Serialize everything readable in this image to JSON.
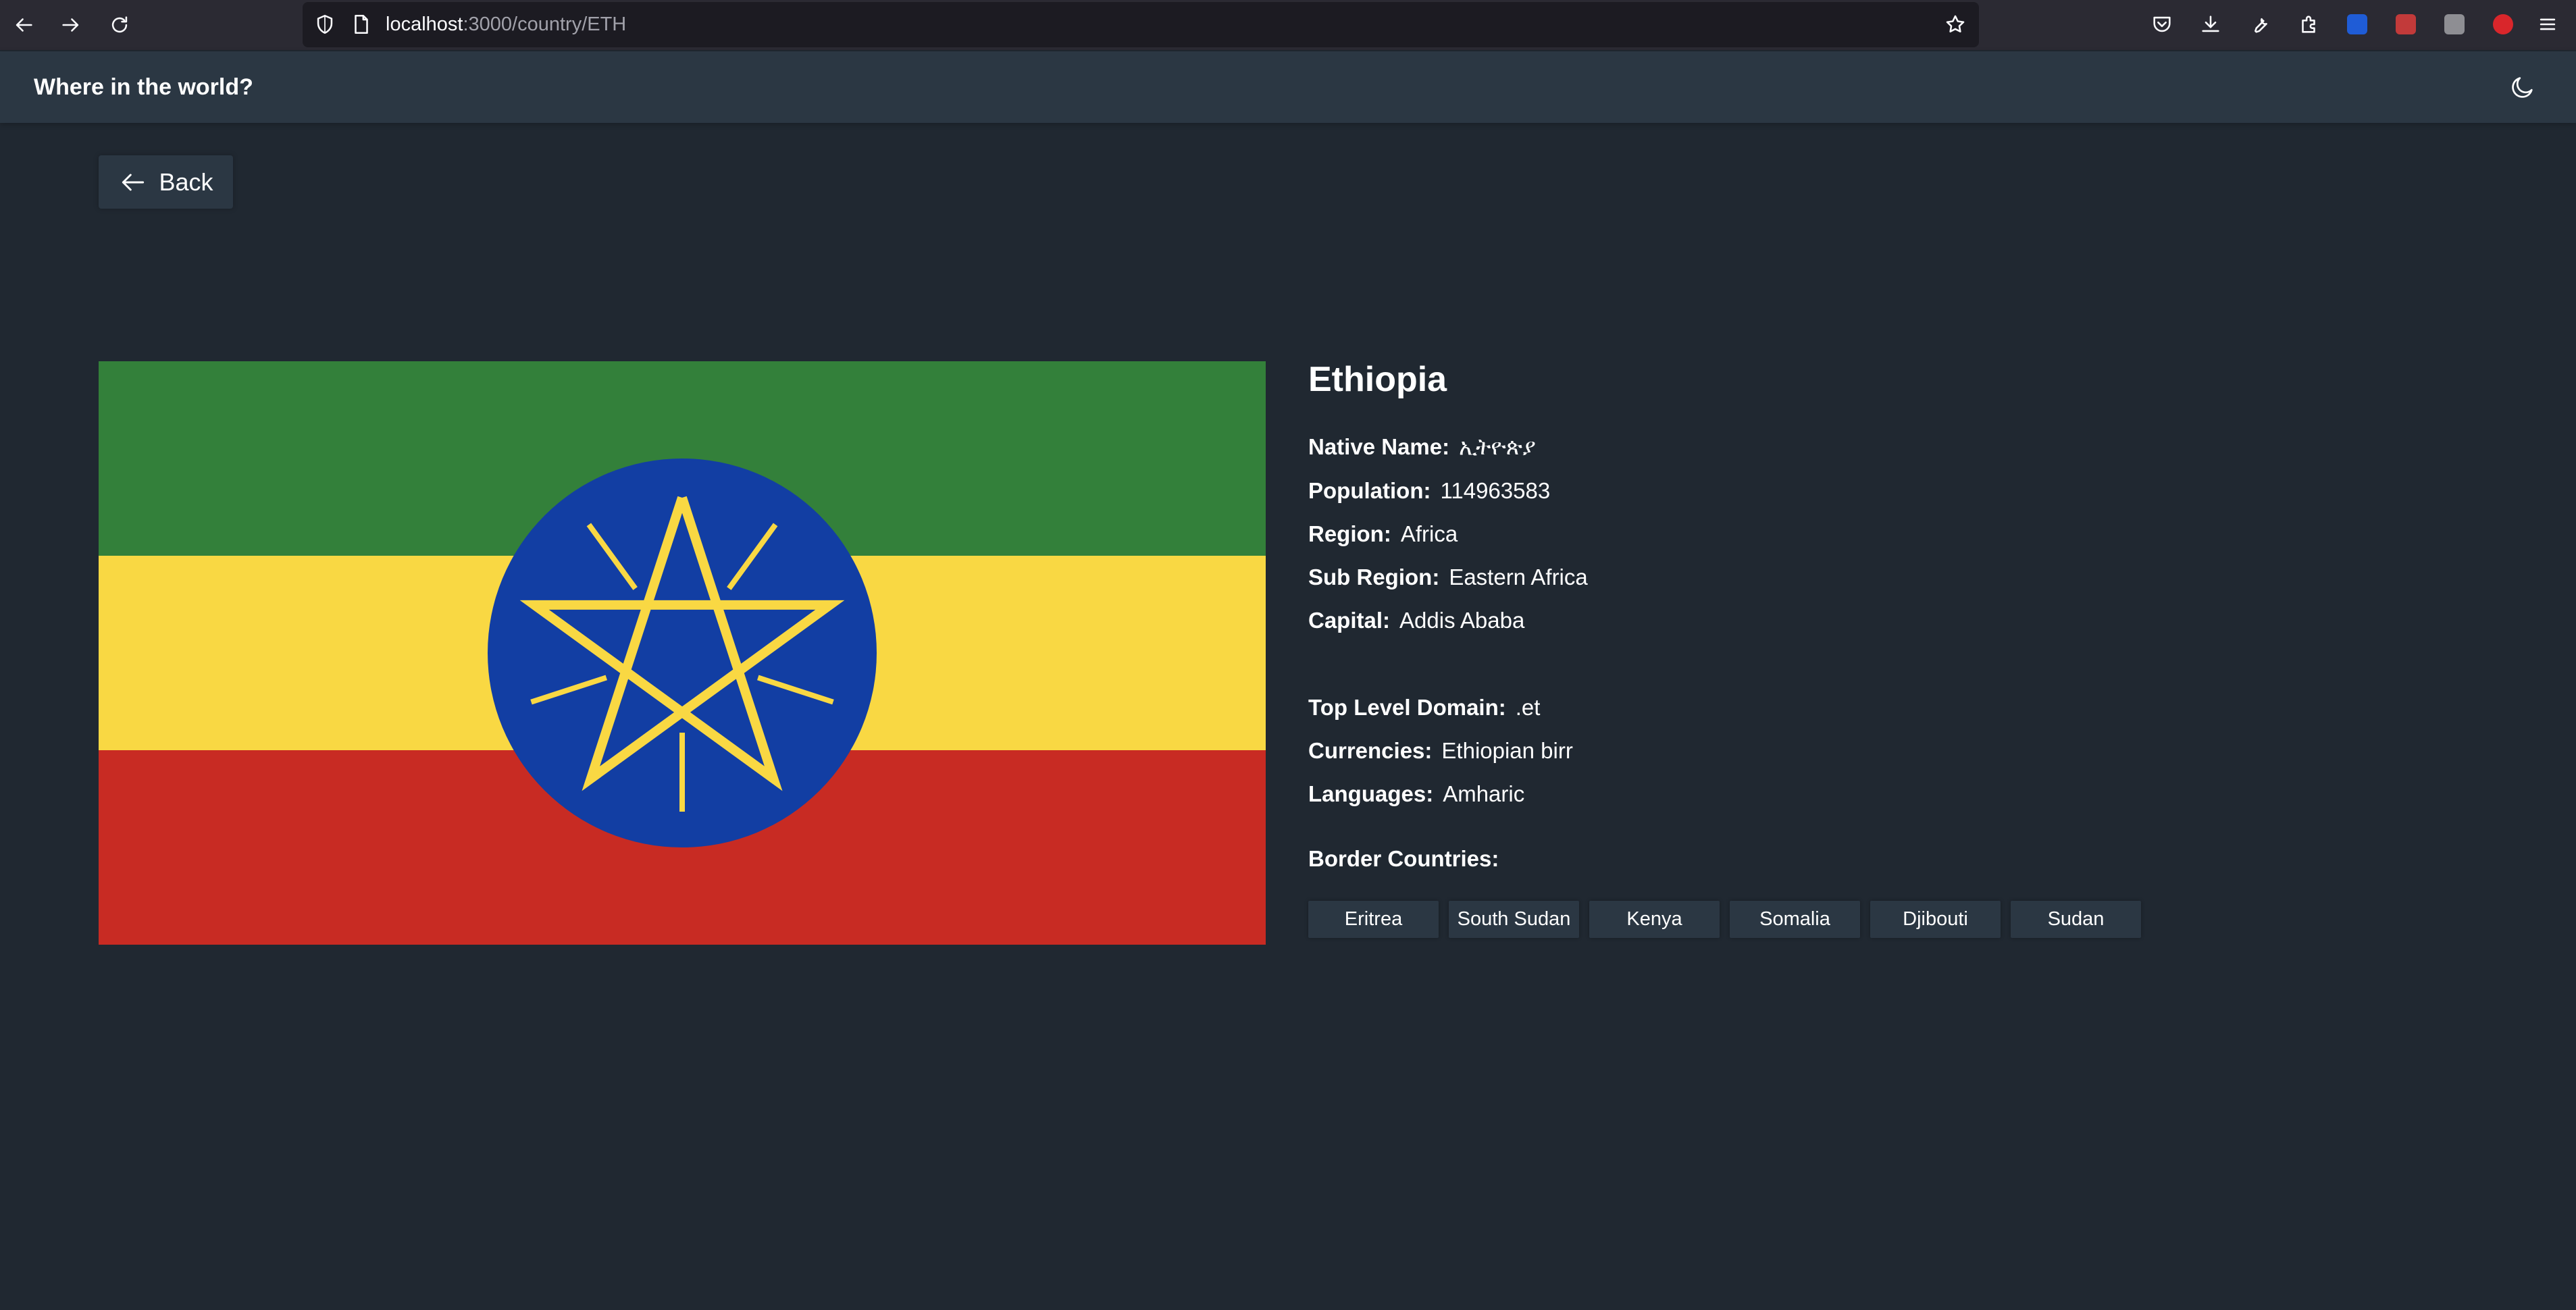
{
  "browser": {
    "url_host": "localhost",
    "url_path": ":3000/country/ETH"
  },
  "header": {
    "title": "Where in the world?",
    "theme_toggle_icon": "moon-icon"
  },
  "back_button": {
    "label": "Back",
    "icon": "arrow-left-icon"
  },
  "flag": {
    "alt": "Flag of Ethiopia",
    "colors": {
      "green": "#33803a",
      "yellow": "#f9d843",
      "red": "#c82b23",
      "blue": "#123ea3",
      "star": "#f9d843"
    }
  },
  "country": {
    "name": "Ethiopia",
    "native_name_label": "Native Name:",
    "native_name": "ኢትዮጵያ",
    "population_label": "Population:",
    "population": "114963583",
    "region_label": "Region:",
    "region": "Africa",
    "sub_region_label": "Sub Region:",
    "sub_region": "Eastern Africa",
    "capital_label": "Capital:",
    "capital": "Addis Ababa",
    "tld_label": "Top Level Domain:",
    "tld": ".et",
    "currencies_label": "Currencies:",
    "currencies": "Ethiopian birr",
    "languages_label": "Languages:",
    "languages": "Amharic",
    "border_label": "Border Countries:",
    "borders": [
      "Eritrea",
      "South Sudan",
      "Kenya",
      "Somalia",
      "Djibouti",
      "Sudan"
    ]
  },
  "colors": {
    "background": "#202831",
    "element": "#2b3743",
    "text": "#ffffff"
  }
}
